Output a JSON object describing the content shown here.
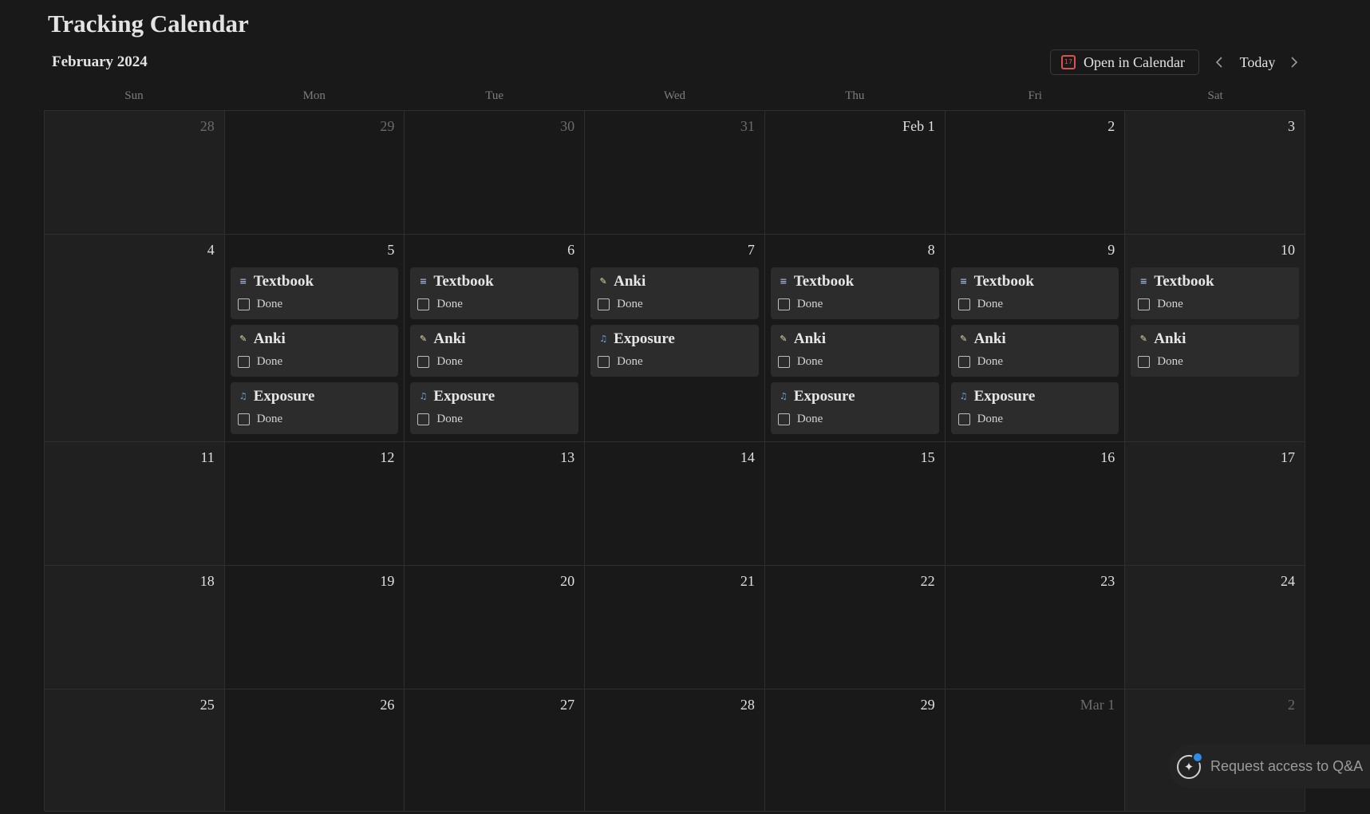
{
  "page": {
    "title": "Tracking Calendar",
    "month": "February 2024"
  },
  "toolbar": {
    "open_label": "Open in Calendar",
    "open_icon_text": "17",
    "today_label": "Today"
  },
  "weekdays": [
    "Sun",
    "Mon",
    "Tue",
    "Wed",
    "Thu",
    "Fri",
    "Sat"
  ],
  "event_icons": {
    "Textbook": {
      "name": "books-icon",
      "glyph": "≡",
      "color": "#9fb3d9"
    },
    "Anki": {
      "name": "memo-icon",
      "glyph": "✎",
      "color": "#e8d9a8"
    },
    "Exposure": {
      "name": "music-notes-icon",
      "glyph": "♫",
      "color": "#6fa8dc"
    }
  },
  "checkbox_label": "Done",
  "weeks": [
    [
      {
        "label": "28",
        "muted": true,
        "events": []
      },
      {
        "label": "29",
        "muted": true,
        "events": []
      },
      {
        "label": "30",
        "muted": true,
        "events": []
      },
      {
        "label": "31",
        "muted": true,
        "events": []
      },
      {
        "label": "Feb 1",
        "muted": false,
        "events": []
      },
      {
        "label": "2",
        "muted": false,
        "events": []
      },
      {
        "label": "3",
        "muted": false,
        "events": []
      }
    ],
    [
      {
        "label": "4",
        "muted": false,
        "events": []
      },
      {
        "label": "5",
        "muted": false,
        "events": [
          {
            "title": "Textbook",
            "done": "Done"
          },
          {
            "title": "Anki",
            "done": "Done"
          },
          {
            "title": "Exposure",
            "done": "Done"
          }
        ]
      },
      {
        "label": "6",
        "muted": false,
        "events": [
          {
            "title": "Textbook",
            "done": "Done"
          },
          {
            "title": "Anki",
            "done": "Done"
          },
          {
            "title": "Exposure",
            "done": "Done"
          }
        ]
      },
      {
        "label": "7",
        "muted": false,
        "events": [
          {
            "title": "Anki",
            "done": "Done"
          },
          {
            "title": "Exposure",
            "done": "Done"
          }
        ]
      },
      {
        "label": "8",
        "muted": false,
        "events": [
          {
            "title": "Textbook",
            "done": "Done"
          },
          {
            "title": "Anki",
            "done": "Done"
          },
          {
            "title": "Exposure",
            "done": "Done"
          }
        ]
      },
      {
        "label": "9",
        "muted": false,
        "events": [
          {
            "title": "Textbook",
            "done": "Done"
          },
          {
            "title": "Anki",
            "done": "Done"
          },
          {
            "title": "Exposure",
            "done": "Done"
          }
        ]
      },
      {
        "label": "10",
        "muted": false,
        "events": [
          {
            "title": "Textbook",
            "done": "Done"
          },
          {
            "title": "Anki",
            "done": "Done"
          }
        ]
      }
    ],
    [
      {
        "label": "11",
        "muted": false,
        "events": []
      },
      {
        "label": "12",
        "muted": false,
        "events": []
      },
      {
        "label": "13",
        "muted": false,
        "events": []
      },
      {
        "label": "14",
        "muted": false,
        "events": []
      },
      {
        "label": "15",
        "muted": false,
        "events": []
      },
      {
        "label": "16",
        "muted": false,
        "events": []
      },
      {
        "label": "17",
        "muted": false,
        "events": []
      }
    ],
    [
      {
        "label": "18",
        "muted": false,
        "events": []
      },
      {
        "label": "19",
        "muted": false,
        "events": []
      },
      {
        "label": "20",
        "muted": false,
        "events": []
      },
      {
        "label": "21",
        "muted": false,
        "events": []
      },
      {
        "label": "22",
        "muted": false,
        "events": []
      },
      {
        "label": "23",
        "muted": false,
        "events": []
      },
      {
        "label": "24",
        "muted": false,
        "events": []
      }
    ],
    [
      {
        "label": "25",
        "muted": false,
        "events": []
      },
      {
        "label": "26",
        "muted": false,
        "events": []
      },
      {
        "label": "27",
        "muted": false,
        "events": []
      },
      {
        "label": "28",
        "muted": false,
        "events": []
      },
      {
        "label": "29",
        "muted": false,
        "events": []
      },
      {
        "label": "Mar 1",
        "muted": true,
        "events": []
      },
      {
        "label": "2",
        "muted": true,
        "events": []
      }
    ]
  ],
  "qa": {
    "label": "Request access to Q&A"
  }
}
